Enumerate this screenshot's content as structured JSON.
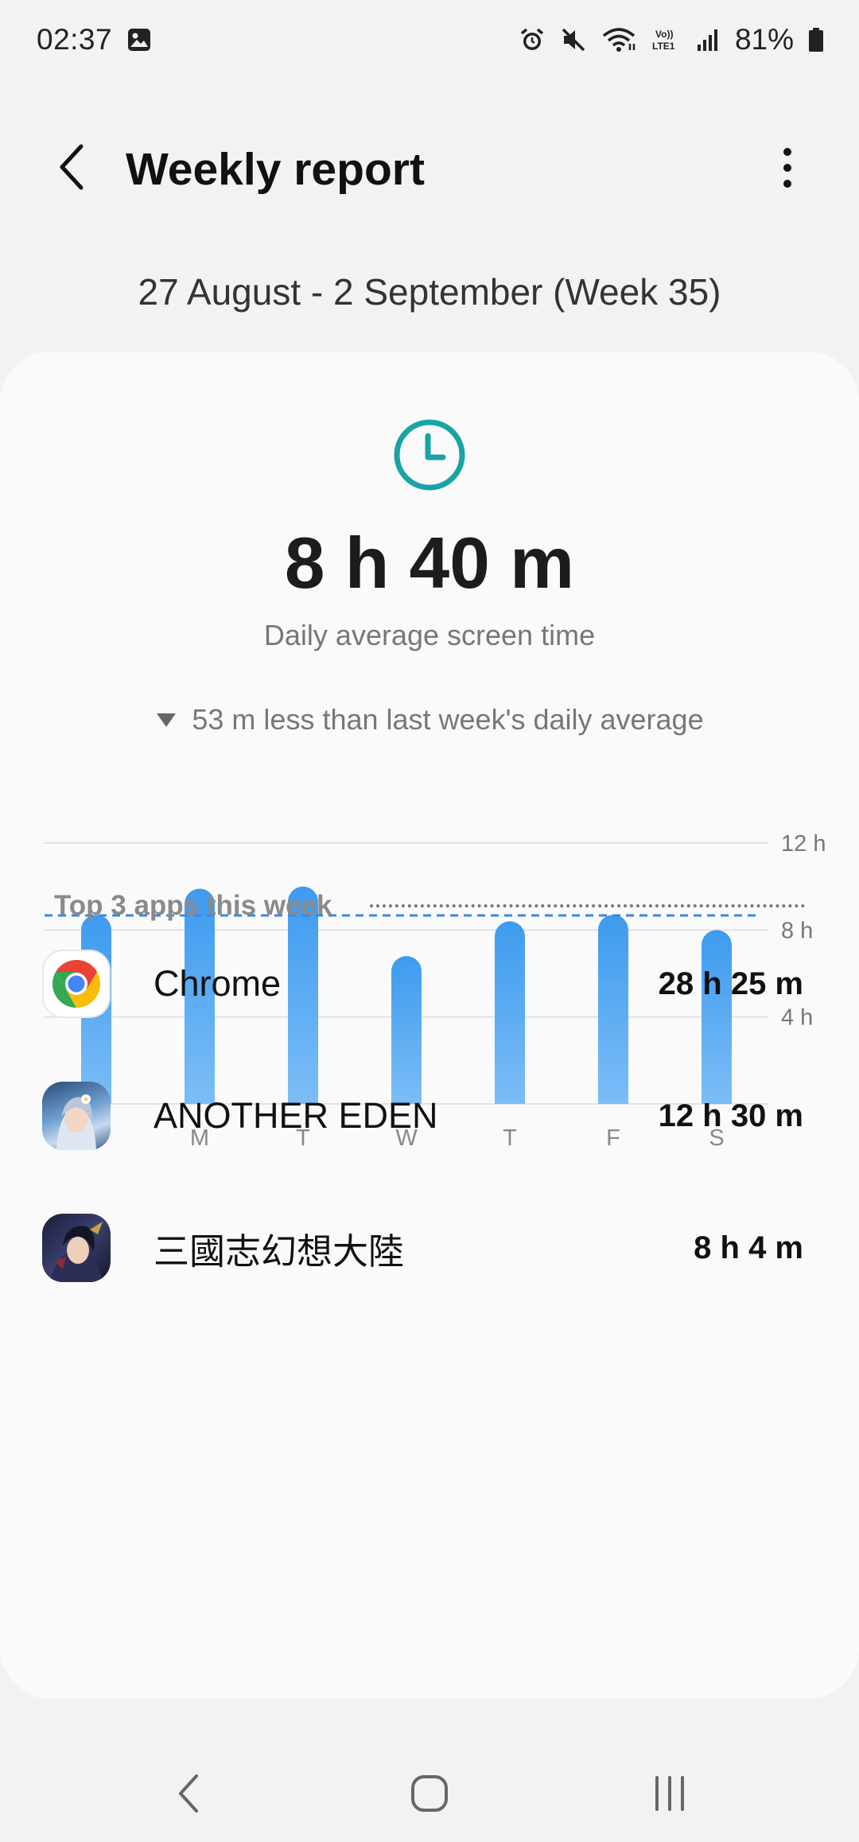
{
  "status_bar": {
    "time": "02:37",
    "battery_percent": "81%",
    "icons": [
      "gallery-icon",
      "alarm-icon",
      "mute-icon",
      "wifi-icon",
      "volte-icon",
      "signal-icon",
      "battery-icon"
    ]
  },
  "app_bar": {
    "title": "Weekly report"
  },
  "week_range": "27 August - 2 September (Week 35)",
  "summary": {
    "daily_average": "8 h 40 m",
    "daily_average_label": "Daily average screen time",
    "comparison": "53 m less than last week's daily average"
  },
  "chart_data": {
    "type": "bar",
    "categories": [
      "S",
      "M",
      "T",
      "W",
      "T",
      "F",
      "S"
    ],
    "values": [
      8.7,
      9.9,
      10.0,
      6.8,
      8.4,
      8.7,
      8.0
    ],
    "ylim": [
      0,
      12
    ],
    "y_ticks": [
      {
        "value": 12,
        "label": "12 h"
      },
      {
        "value": 8,
        "label": "8 h"
      },
      {
        "value": 4,
        "label": "4 h"
      }
    ],
    "average_line": 8.67,
    "colors": {
      "bar_top": "#3d9bee",
      "bar_bottom": "#7cbdf6",
      "average_line": "#3b87e6",
      "grid": "#e2e2e2"
    }
  },
  "top_apps": {
    "title": "Top 3 apps this week",
    "items": [
      {
        "name": "Chrome",
        "time": "28 h 25 m",
        "icon": "chrome-icon"
      },
      {
        "name": "ANOTHER EDEN",
        "time": "12 h 30 m",
        "icon": "another-eden-icon"
      },
      {
        "name": "三國志幻想大陸",
        "time": "8 h 4 m",
        "icon": "sangokushi-icon"
      }
    ]
  },
  "accent_color": "#1aa3a6"
}
